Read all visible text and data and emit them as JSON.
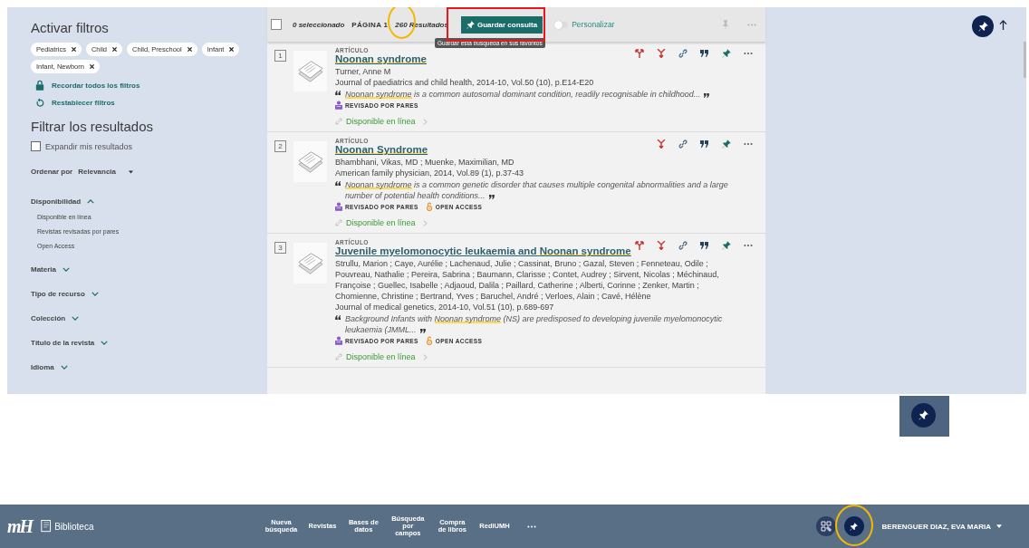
{
  "sidebar": {
    "active_title": "Activar filtros",
    "active_filters": [
      "Pediatrics",
      "Child",
      "Child, Preschool",
      "Infant",
      "Infant, Newborn"
    ],
    "actions": [
      {
        "label": "Recordar todos los filtros",
        "kind": "remember"
      },
      {
        "label": "Restablecer filtros",
        "kind": "reset"
      }
    ],
    "filter_title": "Filtrar los resultados",
    "expand": {
      "label": "Expandir mis resultados",
      "checked": false
    },
    "sort": {
      "label": "Ordenar por",
      "value": "Relevancia"
    },
    "facets": [
      {
        "label": "Disponibilidad",
        "expanded": true,
        "options": [
          "Disponible en línea",
          "Revistas revisadas por pares",
          "Open Access"
        ]
      },
      {
        "label": "Materia",
        "expanded": false
      },
      {
        "label": "Tipo de recurso",
        "expanded": false
      },
      {
        "label": "Colección",
        "expanded": false
      },
      {
        "label": "Título de la revista",
        "expanded": false
      },
      {
        "label": "Idioma",
        "expanded": false
      }
    ]
  },
  "toolbar": {
    "all_selected": false,
    "selected": "0 seleccionado",
    "page": "PÁGINA 1",
    "results": "260 Resultados",
    "save_button": "Guardar consulta",
    "tooltip": "Guardar esta búsqueda en sus favoritos",
    "personalize": {
      "label": "Personalizar",
      "on": false
    }
  },
  "results": [
    {
      "number": "1",
      "type": "ARTÍCULO",
      "title": [
        {
          "text": "Noonan syndrome",
          "highlight": true
        }
      ],
      "authors": "Turner, Anne M",
      "source": "Journal of paediatrics and child health, 2014-10, Vol.50 (10), p.E14-E20",
      "snippet": [
        {
          "text": "Noonan syndrome",
          "highlight": true
        },
        {
          "text": " is a common autosomal dominant condition, readily recognisable in childhood...",
          "highlight": false
        }
      ],
      "badges": [
        {
          "label": "REVISADO POR PARES",
          "kind": "peer"
        }
      ],
      "link": "Disponible en línea",
      "citing": true
    },
    {
      "number": "2",
      "type": "ARTÍCULO",
      "title": [
        {
          "text": "Noonan Syndrome",
          "highlight": true
        }
      ],
      "authors": "Bhambhani, Vikas, MD ; Muenke, Maximilian, MD",
      "source": "American family physician, 2014, Vol.89 (1), p.37-43",
      "snippet": [
        {
          "text": "Noonan syndrome",
          "highlight": true
        },
        {
          "text": " is a common genetic disorder that causes multiple congenital abnormalities and a large number of potential health conditions...",
          "highlight": false
        }
      ],
      "badges": [
        {
          "label": "REVISADO POR PARES",
          "kind": "peer"
        },
        {
          "label": "OPEN ACCESS",
          "kind": "open"
        }
      ],
      "link": "Disponible en línea",
      "citing": false
    },
    {
      "number": "3",
      "type": "ARTÍCULO",
      "title": [
        {
          "text": "Juvenile myelomonocytic leukaemia and ",
          "highlight": false
        },
        {
          "text": "Noonan syndrome",
          "highlight": true
        }
      ],
      "authors": "Strullu, Marion ; Caye, Aurélie ; Lachenaud, Julie ; Cassinat, Bruno ; Gazal, Steven ; Fenneteau, Odile ; Pouvreau, Nathalie ; Pereira, Sabrina ; Baumann, Clarisse ; Contet, Audrey ; Sirvent, Nicolas ; Méchinaud, Françoise ; Guellec, Isabelle ; Adjaoud, Dalila ; Paillard, Catherine ; Alberti, Corinne ; Zenker, Martin ; Chomienne, Christine ; Bertrand, Yves ; Baruchel, André ; Verloes, Alain ; Cavé, Hélène",
      "source": "Journal of medical genetics, 2014-10, Vol.51 (10), p.689-697",
      "snippet": [
        {
          "text": "Background Infants with ",
          "highlight": false
        },
        {
          "text": "Noonan syndrome",
          "highlight": true
        },
        {
          "text": " (NS) are predisposed to developing juvenile myelomonocytic leukaemia (JMML...",
          "highlight": false
        }
      ],
      "badges": [
        {
          "label": "REVISADO POR PARES",
          "kind": "peer"
        },
        {
          "label": "OPEN ACCESS",
          "kind": "open"
        }
      ],
      "link": "Disponible en línea",
      "citing": true
    }
  ],
  "footer": {
    "logo_mark": "mH",
    "logo_text": "Biblioteca",
    "nav": [
      "Nueva búsqueda",
      "Revistas",
      "Bases de datos",
      "Búsqueda por campos",
      "Compra de libros",
      "RediUMH"
    ],
    "user": "BERENGUER DIAZ, EVA MARIA"
  }
}
